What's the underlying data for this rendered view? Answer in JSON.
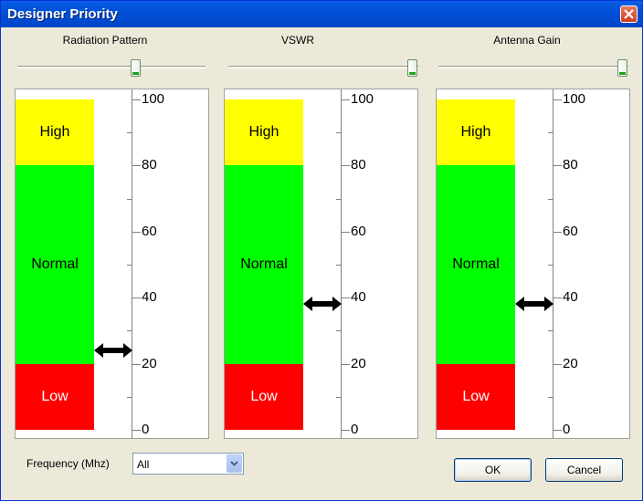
{
  "window": {
    "title": "Designer Priority"
  },
  "gauges": [
    {
      "title": "Radiation Pattern",
      "value": 24
    },
    {
      "title": "VSWR",
      "value": 38
    },
    {
      "title": "Antenna Gain",
      "value": 38
    }
  ],
  "bands": {
    "high": "High",
    "normal": "Normal",
    "low": "Low"
  },
  "ticks": [
    "100",
    "80",
    "60",
    "40",
    "20",
    "0"
  ],
  "frequency": {
    "label": "Frequency (Mhz)",
    "value": "All"
  },
  "buttons": {
    "ok": "OK",
    "cancel": "Cancel"
  }
}
